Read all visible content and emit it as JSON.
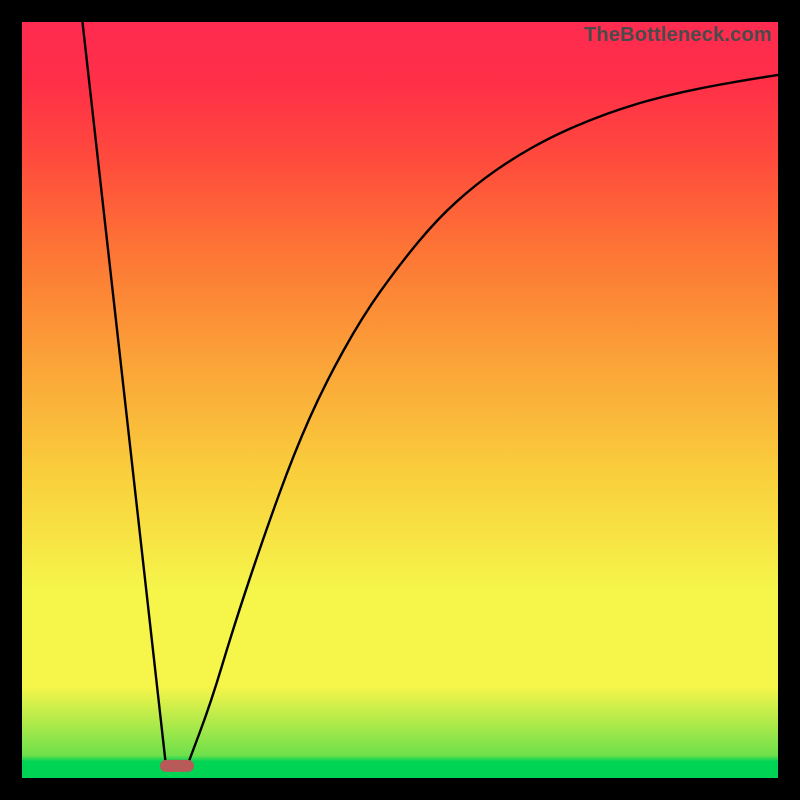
{
  "watermark": "TheBottleneck.com",
  "chart_data": {
    "type": "line",
    "title": "",
    "xlabel": "",
    "ylabel": "",
    "xlim": [
      0,
      100
    ],
    "ylim": [
      0,
      100
    ],
    "left_line": {
      "description": "straight line descending to minimum",
      "start": {
        "x": 8,
        "y": 100
      },
      "end": {
        "x": 19,
        "y": 2
      }
    },
    "right_curve": {
      "description": "asymptotic rise from minimum toward right edge",
      "x": [
        22,
        25,
        28,
        32,
        36,
        40,
        45,
        50,
        55,
        60,
        65,
        70,
        75,
        80,
        85,
        90,
        95,
        100
      ],
      "y": [
        2,
        10,
        20,
        32,
        43,
        52,
        61,
        68,
        74,
        78.5,
        82,
        84.8,
        87,
        88.8,
        90.2,
        91.3,
        92.2,
        93
      ]
    },
    "plateau_marker": {
      "x_center": 20.5,
      "width": 4.5,
      "y": 1.6,
      "color": "#b85a58"
    },
    "gradient_stops": [
      {
        "pos": 0,
        "color": "#00d455"
      },
      {
        "pos": 3,
        "color": "#6fe04b"
      },
      {
        "pos": 12,
        "color": "#f5f54a"
      },
      {
        "pos": 40,
        "color": "#f9cf3c"
      },
      {
        "pos": 70,
        "color": "#fd7435"
      },
      {
        "pos": 100,
        "color": "#ff2b50"
      }
    ]
  }
}
